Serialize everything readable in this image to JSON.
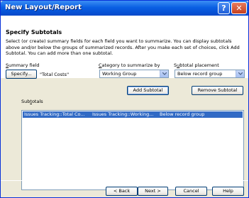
{
  "window": {
    "title": "New Layout/Report"
  },
  "titlebar": {
    "help_label": "?",
    "close_label": "✕"
  },
  "section": {
    "title": "Specify Subtotals",
    "description": "Select (or create) summary fields for each field you want to summarize. You can display subtotals above and/or below the groups of summarized records. After you make each set of choices, click Add Subtotal. You can add more than one subtotal."
  },
  "summary_field": {
    "label_prefix": "",
    "label_hotkey": "S",
    "label_rest": "ummary field",
    "button_label": "Specify...",
    "value": "\"Total Costs\""
  },
  "category": {
    "label_hotkey": "C",
    "label_rest": "ategory to summarize by",
    "selected": "Working Group"
  },
  "placement": {
    "label_prefix": "S",
    "label_hotkey": "u",
    "label_rest": "btotal placement",
    "selected": "Below record group"
  },
  "actions": {
    "add_label": "Add Subtotal",
    "remove_label": "Remove Subtotal"
  },
  "subtotals": {
    "label_prefix": "Sub",
    "label_hotkey": "t",
    "label_rest": "otals",
    "rows": [
      {
        "field": "Issues Tracking::Total Co...",
        "category": "Issues Tracking::Working...",
        "placement": "Below record group"
      }
    ]
  },
  "footer": {
    "back_label": "< Back",
    "next_label": "Next >",
    "cancel_label": "Cancel",
    "help_label": "Help"
  }
}
